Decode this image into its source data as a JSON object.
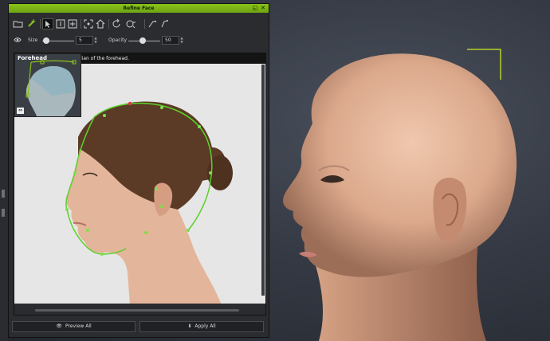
{
  "panel": {
    "title": "Refine Face",
    "title_buttons": [
      "restore-icon",
      "close-icon"
    ]
  },
  "toolbar": {
    "tools": [
      "open-folder-icon",
      "add-point-icon",
      "select-icon",
      "align-vertical-icon",
      "align-both-icon",
      "fit-view-icon",
      "home-icon",
      "rotate-icon",
      "reset-icon",
      "mirror-left-icon",
      "mirror-right-icon"
    ]
  },
  "sliders": {
    "size_label": "Size",
    "size_value": "5",
    "opacity_label": "Opacity",
    "opacity_value": "50"
  },
  "canvas": {
    "region_label": "Forehead",
    "hint": "Median of the forehead."
  },
  "buttons": {
    "preview_all": "Preview All",
    "apply_all": "Apply All"
  },
  "colors": {
    "accent": "#7cb518",
    "curve": "#5bd12a",
    "panel": "#2b2c30"
  }
}
